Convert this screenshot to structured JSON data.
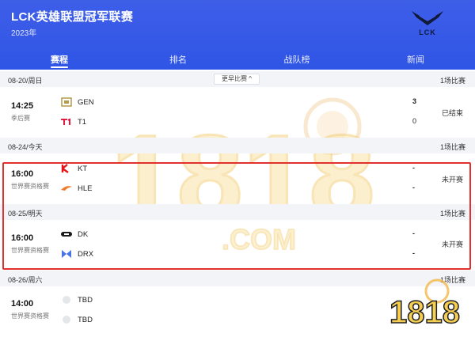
{
  "header": {
    "title": "LCK英雄联盟冠军联赛",
    "year": "2023年",
    "logo_text": "LCK"
  },
  "tabs": [
    {
      "label": "赛程",
      "active": true
    },
    {
      "label": "排名",
      "active": false
    },
    {
      "label": "战队榜",
      "active": false
    },
    {
      "label": "新闻",
      "active": false
    }
  ],
  "earlier_button": "更早比赛 ^",
  "days": [
    {
      "date": "08-20/周日",
      "count": "1场比赛"
    },
    {
      "date": "08-24/今天",
      "count": "1场比赛"
    },
    {
      "date": "08-25/明天",
      "count": "1场比赛"
    },
    {
      "date": "08-26/周六",
      "count": "1场比赛"
    }
  ],
  "matches": [
    {
      "time": "14:25",
      "stage": "季后赛",
      "team1": "GEN",
      "team2": "T1",
      "score1": "3",
      "score2": "0",
      "status": "已结束",
      "logo1": "gen-logo-icon",
      "logo2": "t1-logo-icon"
    },
    {
      "time": "16:00",
      "stage": "世界赛资格赛",
      "team1": "KT",
      "team2": "HLE",
      "score1": "-",
      "score2": "-",
      "status": "未开赛",
      "logo1": "kt-logo-icon",
      "logo2": "hle-logo-icon"
    },
    {
      "time": "16:00",
      "stage": "世界赛资格赛",
      "team1": "DK",
      "team2": "DRX",
      "score1": "-",
      "score2": "-",
      "status": "未开赛",
      "logo1": "dk-logo-icon",
      "logo2": "drx-logo-icon"
    },
    {
      "time": "14:00",
      "stage": "世界赛资格赛",
      "team1": "TBD",
      "team2": "TBD",
      "score1": "",
      "score2": "",
      "status": "",
      "logo1": "tbd-logo-icon",
      "logo2": "tbd-logo-icon"
    }
  ],
  "watermark": {
    "text": "1818",
    "suffix": ".COM",
    "small_text": "1818"
  },
  "colors": {
    "header_blue": "#2f55e6",
    "highlight_red": "#e0312f",
    "date_bar_bg": "#f2f4f7"
  }
}
